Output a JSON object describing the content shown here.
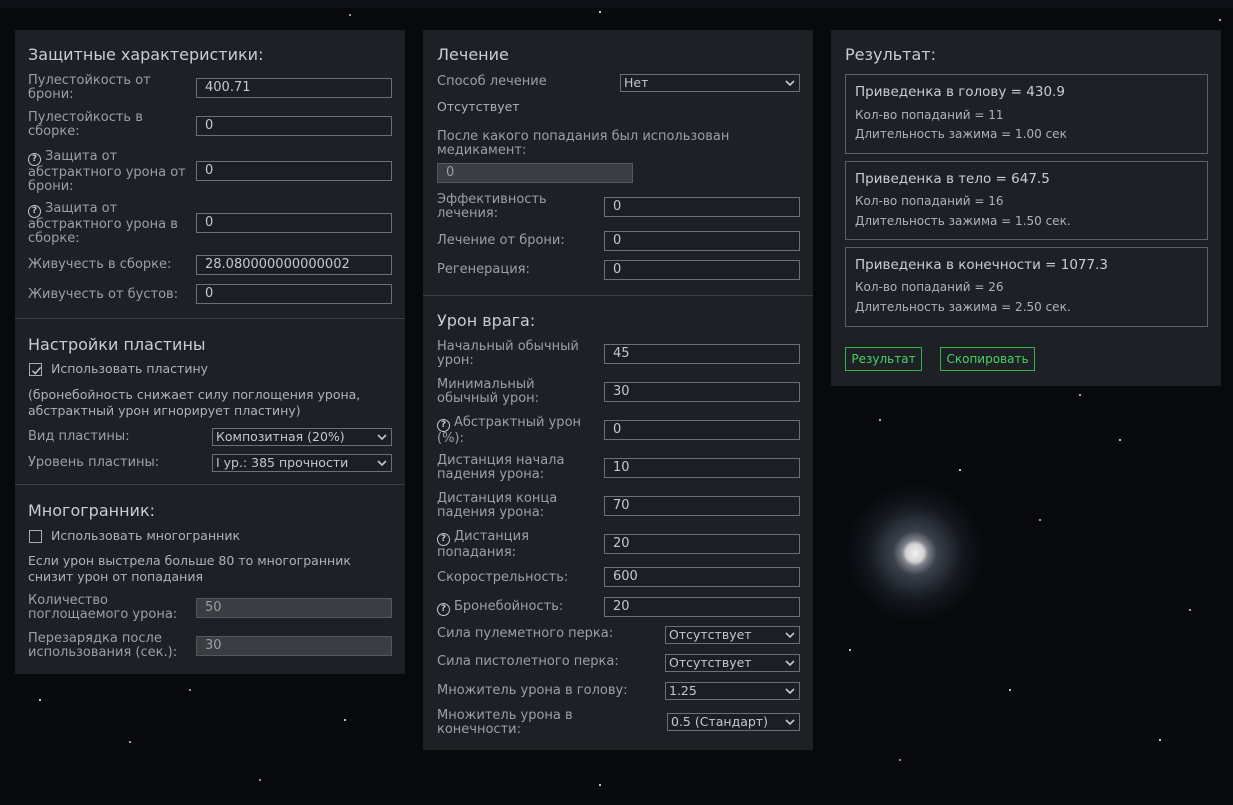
{
  "defense": {
    "title": "Защитные характеристики:",
    "fields": [
      {
        "label": "Пулестойкость от брони:",
        "value": "400.71"
      },
      {
        "label": "Пулестойкость в сборке:",
        "value": "0"
      },
      {
        "label": "Защита от абстрактного урона от брони:",
        "value": "0"
      },
      {
        "label": "Защита от абстрактного урона в сборке:",
        "value": "0"
      },
      {
        "label": "Живучесть в сборке:",
        "value": "28.080000000000002"
      },
      {
        "label": "Живучесть от бустов:",
        "value": "0"
      }
    ]
  },
  "plate": {
    "title": "Настройки пластины",
    "use_label": "Использовать пластину",
    "use_checked": true,
    "note": "(бронебойность снижает силу поглощения урона, абстрактный урон игнорирует пластину)",
    "type_label": "Вид пластины:",
    "type_value": "Композитная (20%)",
    "level_label": "Уровень пластины:",
    "level_value": "I ур.: 385 прочности"
  },
  "polyhedron": {
    "title": "Многогранник:",
    "use_label": "Использовать многогранник",
    "use_checked": false,
    "note": "Если урон выстрела больше 80 то многогранник снизит урон от попадания",
    "absorb_label": "Количество поглощаемого урона:",
    "absorb_value": "50",
    "reload_label": "Перезарядка после использования (сек.):",
    "reload_value": "30"
  },
  "healing": {
    "title": "Лечение",
    "method_label": "Способ лечение",
    "method_value": "Нет",
    "status": "Отсутствует",
    "after_hit_label": "После какого попадания был использован медикамент:",
    "after_hit_value": "0",
    "efficiency_label": "Эффективность лечения:",
    "efficiency_value": "0",
    "armor_heal_label": "Лечение от брони:",
    "armor_heal_value": "0",
    "regen_label": "Регенерация:",
    "regen_value": "0"
  },
  "enemy": {
    "title": "Урон врага:",
    "fields": [
      {
        "label": "Начальный обычный урон:",
        "value": "45"
      },
      {
        "label": "Минимальный обычный урон:",
        "value": "30"
      },
      {
        "label": "Абстрактный урон (%):",
        "value": "0"
      },
      {
        "label": "Дистанция начала падения урона:",
        "value": "10"
      },
      {
        "label": "Дистанция конца падения урона:",
        "value": "70"
      },
      {
        "label": "Дистанция попадания:",
        "value": "20"
      },
      {
        "label": "Скорострельность:",
        "value": "600"
      },
      {
        "label": "Бронебойность:",
        "value": "20"
      }
    ],
    "selects": [
      {
        "label": "Сила пулеметного перка:",
        "value": "Отсутствует"
      },
      {
        "label": "Сила пистолетного перка:",
        "value": "Отсутствует"
      },
      {
        "label": "Множитель урона в голову:",
        "value": "1.25"
      },
      {
        "label": "Множитель урона в конечности:",
        "value": "0.5 (Стандарт)"
      }
    ]
  },
  "result": {
    "title": "Результат:",
    "boxes": [
      {
        "title": "Приведенка в голову = 430.9",
        "hits": "Кол-во попаданий = 11",
        "hold": "Длительность зажима = 1.00 сек"
      },
      {
        "title": "Приведенка в тело = 647.5",
        "hits": "Кол-во попаданий = 16",
        "hold": "Длительность зажима = 1.50 сек."
      },
      {
        "title": "Приведенка в конечности = 1077.3",
        "hits": "Кол-во попаданий = 26",
        "hold": "Длительность зажима = 2.50 сек."
      }
    ],
    "result_button": "Результат",
    "copy_button": "Скопировать"
  },
  "colors": {
    "panel": "#1d2126",
    "accent_green": "#31b34a",
    "background": "#07090c"
  }
}
